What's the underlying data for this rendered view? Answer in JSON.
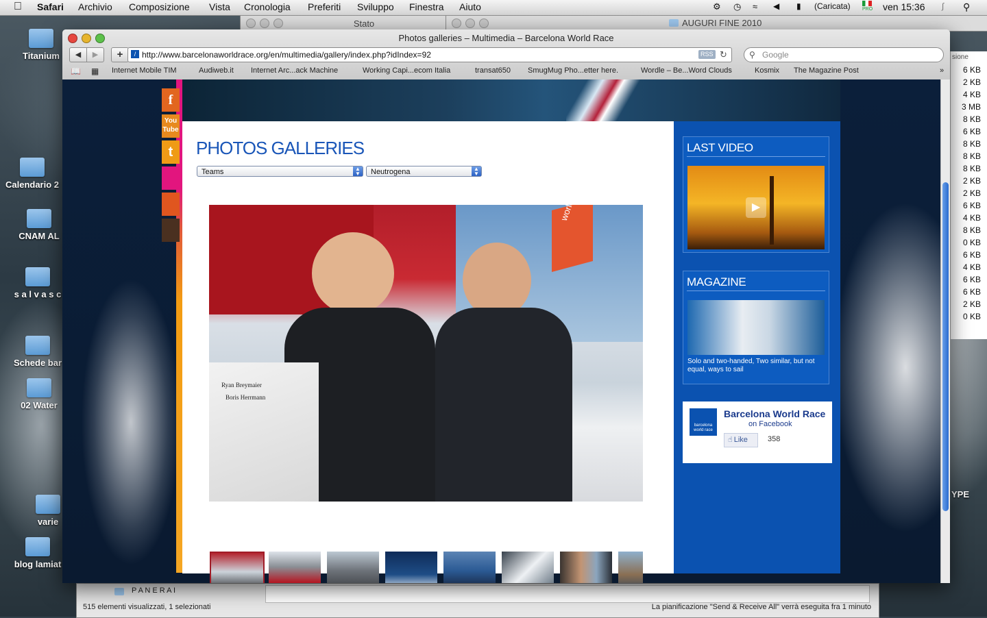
{
  "menubar": {
    "app": "Safari",
    "items": [
      "Archivio",
      "Composizione",
      "Vista",
      "Cronologia",
      "Preferiti",
      "Sviluppo",
      "Finestra",
      "Aiuto"
    ],
    "battery": "(Caricata)",
    "flag_label": "PRO",
    "clock": "ven 15:36"
  },
  "desktop": {
    "icons": [
      "Titanium",
      "Calendario 2",
      "CNAM AL",
      "s a l v a s c",
      "Schede bar",
      "02 Water",
      "varie",
      "blog lamiat"
    ],
    "right_text": "YPE"
  },
  "background_windows": {
    "stato_title": "Stato",
    "auguri_title": "AUGURI FINE 2010",
    "panerai_label": "P A N E R A I",
    "finder_status": "515 elementi visualizzati, 1 selezionati",
    "mail_status": "La pianificazione \"Send & Receive All\" verrà eseguita fra 1 minuto",
    "finder_column_header": "sione",
    "sizes": [
      "6 KB",
      "2 KB",
      "4 KB",
      "3 MB",
      "8 KB",
      "6 KB",
      "8 KB",
      "8 KB",
      "8 KB",
      "2 KB",
      "2 KB",
      "6 KB",
      "4 KB",
      "8 KB",
      "0 KB",
      "6 KB",
      "4 KB",
      "6 KB",
      "6 KB",
      "2 KB",
      "0 KB"
    ]
  },
  "browser": {
    "title": "Photos galleries – Multimedia – Barcelona World Race",
    "url": "http://www.barcelonaworldrace.org/en/multimedia/gallery/index.php?idIndex=92",
    "rss_label": "RSS",
    "search_placeholder": "Google",
    "bookmarks": [
      "Internet Mobile TIM",
      "Audiweb.it",
      "Internet Arc...ack Machine",
      "Working Capi...ecom Italia",
      "transat650",
      "SmugMug Pho...etter here.",
      "Wordle – Be...Word Clouds",
      "Kosmix",
      "The Magazine Post"
    ]
  },
  "page": {
    "heading": "PHOTOS GALLERIES",
    "dropdown_category": "Teams",
    "dropdown_team": "Neutrogena",
    "photo_names": [
      "Ryan Breymaier",
      "Boris Herrmann"
    ],
    "flag_text": "world race",
    "social": [
      "f",
      "You Tube",
      "t"
    ],
    "last_video_title": "LAST VIDEO",
    "magazine_title": "MAGAZINE",
    "magazine_caption": "Solo and two-handed, Two similar, but not equal, ways to sail",
    "fb_name": "Barcelona World Race",
    "fb_on": "on Facebook",
    "fb_logo_text": "barcelona world race",
    "fb_like": "Like",
    "fb_count": "358"
  },
  "colors": {
    "accent_blue": "#0b52b0",
    "heading_blue": "#1a56b8",
    "stripe_pink": "#e2157e",
    "stripe_orange": "#f5a623"
  }
}
